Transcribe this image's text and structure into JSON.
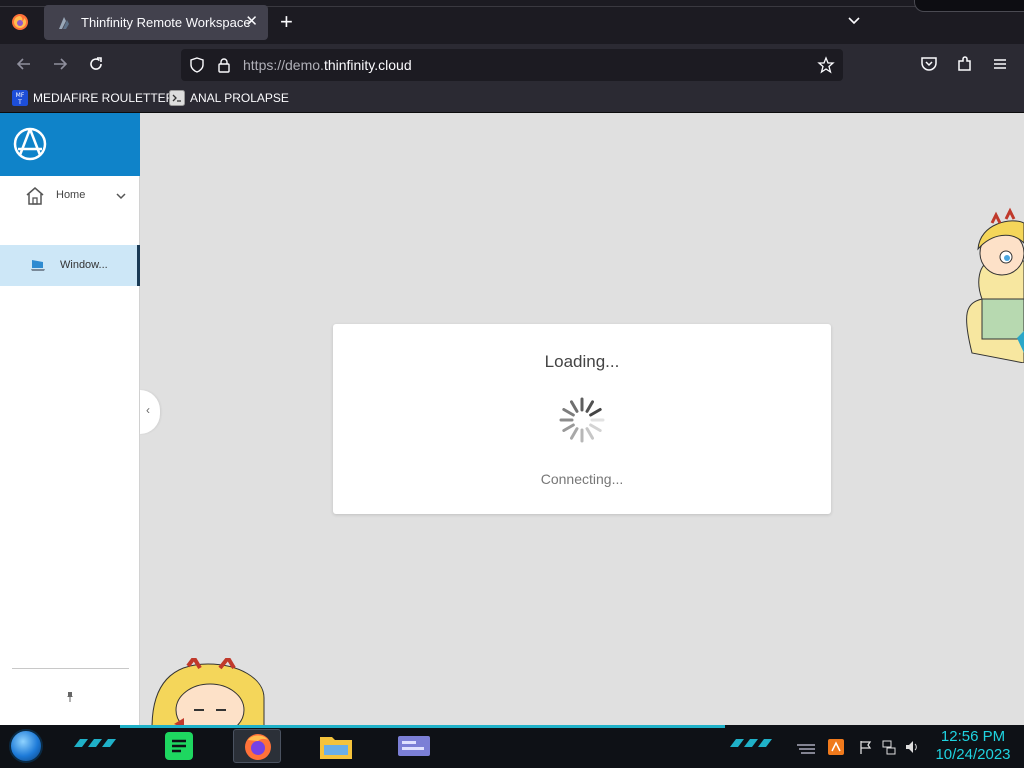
{
  "browser": {
    "tab": {
      "title": "Thinfinity Remote Workspace",
      "close": "✕"
    },
    "new_tab": "+",
    "url": {
      "prefix": "https://demo.",
      "domain": "thinfinity.cloud"
    },
    "bookmarks": [
      {
        "label": "MEDIAFIRE ROULETTER",
        "icon": "mediafire-icon"
      },
      {
        "label": "ANAL PROLAPSE",
        "icon": "terminal-icon"
      }
    ]
  },
  "app": {
    "nav": {
      "home_label": "Home",
      "window_label": "Window..."
    },
    "collapse": "‹",
    "loading": {
      "title": "Loading...",
      "status": "Connecting..."
    },
    "colors": {
      "brand": "#0f83c9",
      "selected": "#cde7f7",
      "page_bg": "#e0e0e0"
    }
  },
  "taskbar": {
    "time": "12:56 PM",
    "date": "10/24/2023",
    "apps": [
      "spotify-icon",
      "firefox-icon",
      "file-explorer-icon",
      "window-app-icon"
    ],
    "accent": "#1fb1c8"
  }
}
